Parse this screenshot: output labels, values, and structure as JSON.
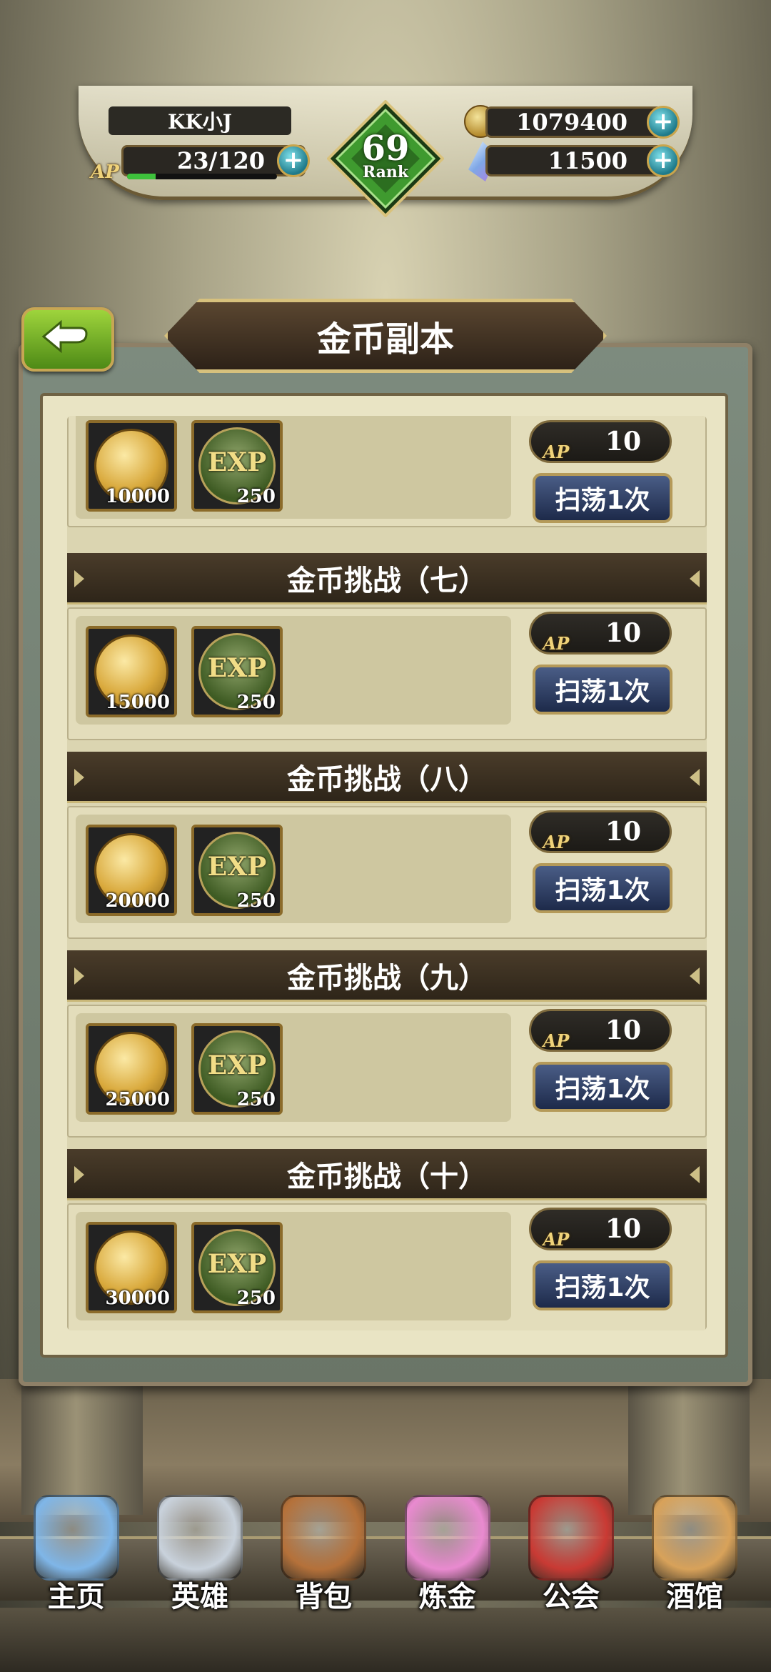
{
  "player": {
    "name": "KK小J",
    "ap_label": "AP",
    "ap_value": "23/120",
    "ap_fraction": 0.19,
    "gold": "1079400",
    "gems": "11500",
    "rank": "69",
    "rank_label": "Rank"
  },
  "header": {
    "title": "金币副本",
    "back_icon": "back-arrow-icon"
  },
  "stages": [
    {
      "title": "",
      "coin_reward": "10000",
      "exp_label": "EXP",
      "exp_reward": "250",
      "ap_label": "AP",
      "ap_cost": "10",
      "sweep_label": "扫荡1次"
    },
    {
      "title": "金币挑战（七）",
      "coin_reward": "15000",
      "exp_label": "EXP",
      "exp_reward": "250",
      "ap_label": "AP",
      "ap_cost": "10",
      "sweep_label": "扫荡1次"
    },
    {
      "title": "金币挑战（八）",
      "coin_reward": "20000",
      "exp_label": "EXP",
      "exp_reward": "250",
      "ap_label": "AP",
      "ap_cost": "10",
      "sweep_label": "扫荡1次"
    },
    {
      "title": "金币挑战（九）",
      "coin_reward": "25000",
      "exp_label": "EXP",
      "exp_reward": "250",
      "ap_label": "AP",
      "ap_cost": "10",
      "sweep_label": "扫荡1次"
    },
    {
      "title": "金币挑战（十）",
      "coin_reward": "30000",
      "exp_label": "EXP",
      "exp_reward": "250",
      "ap_label": "AP",
      "ap_cost": "10",
      "sweep_label": "扫荡1次"
    }
  ],
  "nav": [
    {
      "label": "主页",
      "icon": "castle-icon",
      "color": "#7fb6e8"
    },
    {
      "label": "英雄",
      "icon": "knight-helmet-icon",
      "color": "#c9d2dc"
    },
    {
      "label": "背包",
      "icon": "backpack-icon",
      "color": "#b5713a"
    },
    {
      "label": "炼金",
      "icon": "alchemy-flask-icon",
      "color": "#e98ad0"
    },
    {
      "label": "公会",
      "icon": "guild-shield-icon",
      "color": "#c93a34"
    },
    {
      "label": "酒馆",
      "icon": "tavern-mug-icon",
      "color": "#d8a25a"
    }
  ],
  "colors": {
    "accent_gold": "#c9a54c",
    "sweep_button": "#2a3a62",
    "panel_bg": "#e9e4c4",
    "header_bg": "#2e2519"
  }
}
